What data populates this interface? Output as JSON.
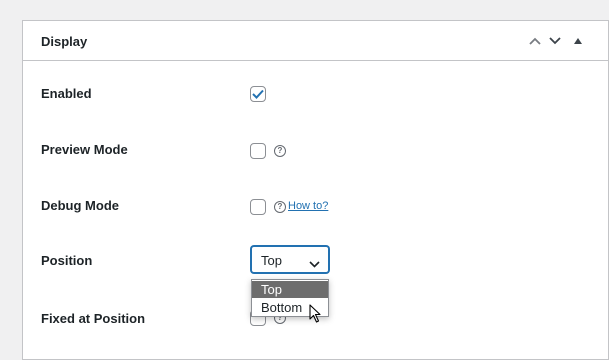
{
  "panel": {
    "title": "Display",
    "controls": [
      "chevron-up-icon",
      "chevron-down-icon",
      "triangle-up-icon"
    ]
  },
  "rows": {
    "enabled": {
      "label": "Enabled",
      "checked": true
    },
    "preview_mode": {
      "label": "Preview Mode",
      "checked": false,
      "help": "?"
    },
    "debug_mode": {
      "label": "Debug Mode",
      "checked": false,
      "help": "?",
      "link": "How to?"
    },
    "position": {
      "label": "Position",
      "value": "Top",
      "options": [
        "Top",
        "Bottom"
      ]
    },
    "fixed_at_position": {
      "label": "Fixed at Position",
      "checked": false,
      "help": "?"
    }
  },
  "colors": {
    "accent": "#2271b1",
    "border": "#c3c4c7",
    "background": "#f0f0f1"
  }
}
